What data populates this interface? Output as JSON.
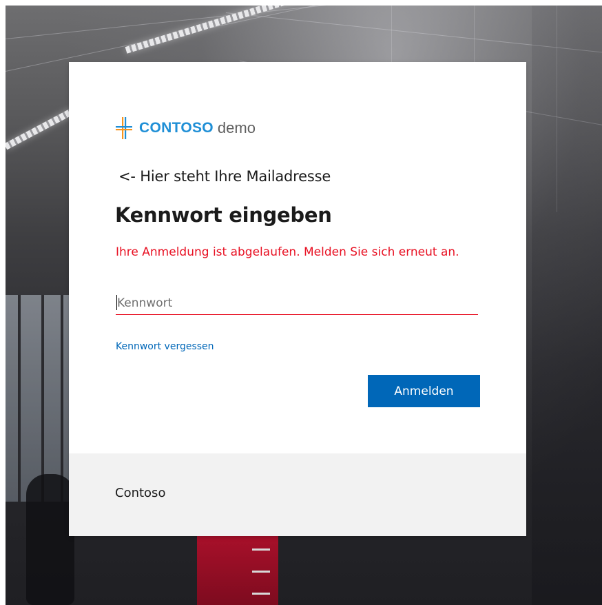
{
  "logo": {
    "brand": "CONTOSO",
    "suffix": "demo",
    "brand_color": "#1f8fd6",
    "mark_colors": [
      "#1f8fd6",
      "#f7941d"
    ]
  },
  "identity_hint": "<- Hier steht Ihre Mailadresse",
  "title": "Kennwort eingeben",
  "error_message": "Ihre Anmeldung ist abgelaufen. Melden Sie sich erneut an.",
  "password": {
    "placeholder": "Kennwort",
    "value": ""
  },
  "forgot_link": "Kennwort vergessen",
  "signin_button": "Anmelden",
  "footer_text": "Contoso",
  "colors": {
    "accent": "#0067b8",
    "error": "#e81123",
    "footer_bg": "#f2f2f2"
  }
}
